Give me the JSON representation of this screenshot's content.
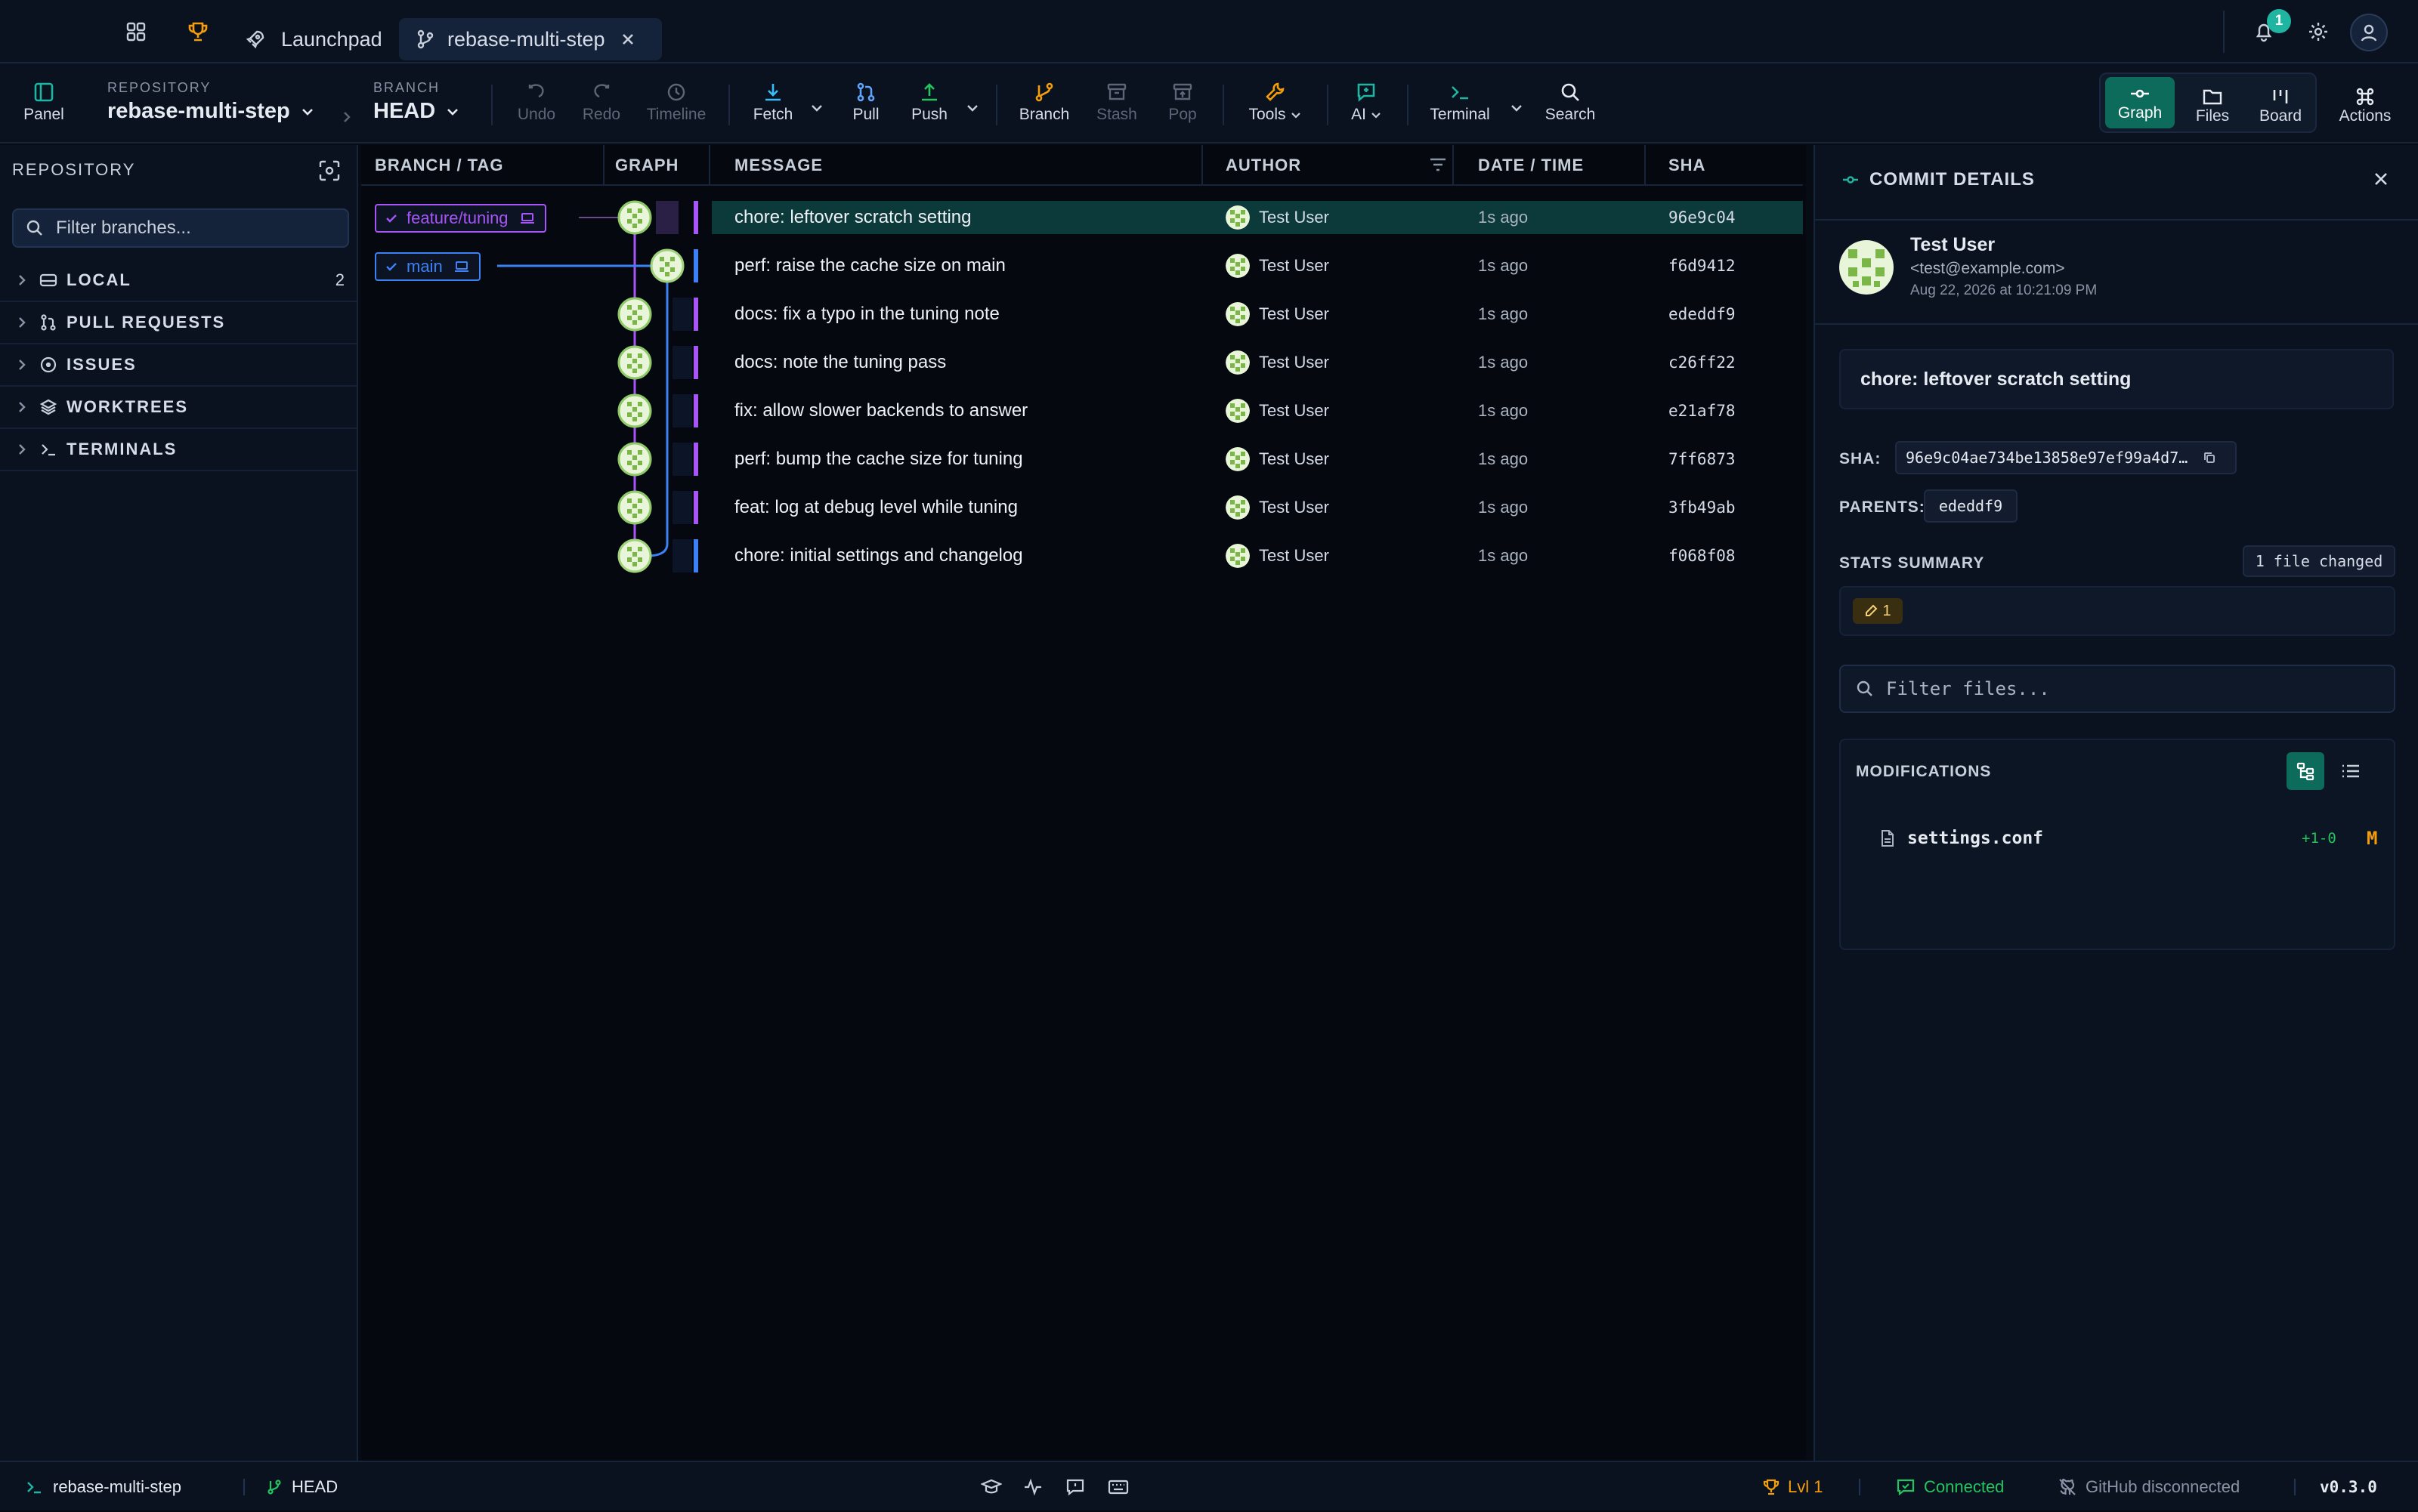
{
  "tabs": {
    "launchpad": "Launchpad",
    "repo": "rebase-multi-step"
  },
  "notifications": {
    "count": "1"
  },
  "toolbar": {
    "panel": "Panel",
    "repo_caption": "REPOSITORY",
    "repo_name": "rebase-multi-step",
    "branch_caption": "BRANCH",
    "branch_name": "HEAD",
    "undo": "Undo",
    "redo": "Redo",
    "timeline": "Timeline",
    "fetch": "Fetch",
    "pull": "Pull",
    "push": "Push",
    "branch": "Branch",
    "stash": "Stash",
    "pop": "Pop",
    "tools": "Tools",
    "ai": "AI",
    "terminal": "Terminal",
    "search": "Search",
    "graph": "Graph",
    "files": "Files",
    "board": "Board",
    "actions": "Actions"
  },
  "sidebar": {
    "title": "REPOSITORY",
    "filter_placeholder": "Filter branches...",
    "sections": [
      {
        "label": "LOCAL",
        "count": "2"
      },
      {
        "label": "PULL REQUESTS",
        "count": ""
      },
      {
        "label": "ISSUES",
        "count": ""
      },
      {
        "label": "WORKTREES",
        "count": ""
      },
      {
        "label": "TERMINALS",
        "count": ""
      }
    ]
  },
  "graph": {
    "columns": {
      "branch": "BRANCH / TAG",
      "graph": "GRAPH",
      "message": "MESSAGE",
      "author": "AUTHOR",
      "date": "DATE / TIME",
      "sha": "SHA"
    },
    "refs": [
      {
        "label": "feature/tuning",
        "color": "#a855f7"
      },
      {
        "label": "main",
        "color": "#3b82f6"
      }
    ],
    "commits": [
      {
        "message": "chore: leftover scratch setting",
        "author": "Test User",
        "date": "1s ago",
        "sha": "96e9c04"
      },
      {
        "message": "perf: raise the cache size on main",
        "author": "Test User",
        "date": "1s ago",
        "sha": "f6d9412"
      },
      {
        "message": "docs: fix a typo in the tuning note",
        "author": "Test User",
        "date": "1s ago",
        "sha": "ededdf9"
      },
      {
        "message": "docs: note the tuning pass",
        "author": "Test User",
        "date": "1s ago",
        "sha": "c26ff22"
      },
      {
        "message": "fix: allow slower backends to answer",
        "author": "Test User",
        "date": "1s ago",
        "sha": "e21af78"
      },
      {
        "message": "perf: bump the cache size for tuning",
        "author": "Test User",
        "date": "1s ago",
        "sha": "7ff6873"
      },
      {
        "message": "feat: log at debug level while tuning",
        "author": "Test User",
        "date": "1s ago",
        "sha": "3fb49ab"
      },
      {
        "message": "chore: initial settings and changelog",
        "author": "Test User",
        "date": "1s ago",
        "sha": "f068f08"
      }
    ]
  },
  "details": {
    "title": "COMMIT DETAILS",
    "author_name": "Test User",
    "author_email": "<test@example.com>",
    "date": "Aug 22, 2026 at 10:21:09 PM",
    "message": "chore: leftover scratch setting",
    "sha_label": "SHA:",
    "sha_value": "96e9c04ae734be13858e97ef99a4d7…",
    "parents_label": "PARENTS:",
    "parent": "ededdf9",
    "stats_label": "STATS SUMMARY",
    "files_changed": "1 file changed",
    "modified_count": "1",
    "filter_placeholder": "Filter files...",
    "modifications_label": "MODIFICATIONS",
    "files": [
      {
        "name": "settings.conf",
        "stat": "+1-0",
        "status": "M"
      }
    ]
  },
  "status": {
    "repo": "rebase-multi-step",
    "branch": "HEAD",
    "level": "Lvl 1",
    "connection": "Connected",
    "github": "GitHub disconnected",
    "version": "v0.3.0"
  },
  "colors": {
    "accent": "#1fb5a0",
    "feature": "#a855f7",
    "main": "#3b82f6",
    "selected_row": "#0c3a3a"
  }
}
